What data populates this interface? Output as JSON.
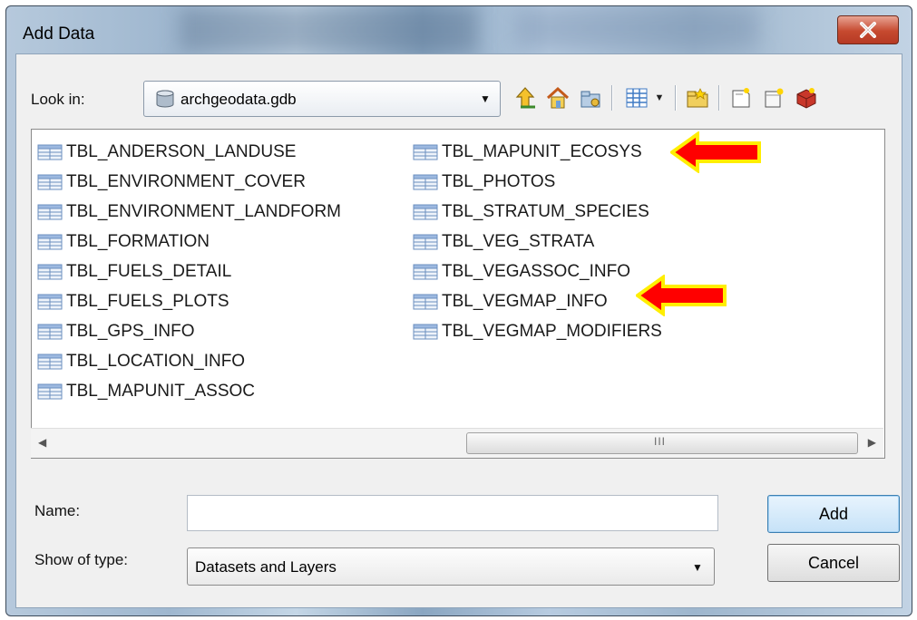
{
  "window": {
    "title": "Add Data"
  },
  "look_in": {
    "label": "Look in:",
    "value": "archgeodata.gdb"
  },
  "toolbar": {
    "icons": [
      "up-one-level-icon",
      "home-icon",
      "connect-folder-icon",
      "view-list-icon",
      "new-folder-icon",
      "new-file-icon",
      "new-shapefile-icon",
      "toolbox-icon"
    ]
  },
  "files": {
    "column1": [
      "TBL_ANDERSON_LANDUSE",
      "TBL_ENVIRONMENT_COVER",
      "TBL_ENVIRONMENT_LANDFORM",
      "TBL_FORMATION",
      "TBL_FUELS_DETAIL",
      "TBL_FUELS_PLOTS",
      "TBL_GPS_INFO",
      "TBL_LOCATION_INFO",
      "TBL_MAPUNIT_ASSOC"
    ],
    "column2": [
      "TBL_MAPUNIT_ECOSYS",
      "TBL_PHOTOS",
      "TBL_STRATUM_SPECIES",
      "TBL_VEG_STRATA",
      "TBL_VEGASSOC_INFO",
      "TBL_VEGMAP_INFO",
      "TBL_VEGMAP_MODIFIERS"
    ],
    "highlighted": [
      "TBL_MAPUNIT_ECOSYS",
      "TBL_VEGMAP_INFO"
    ]
  },
  "scrollbar": {
    "grip": "III"
  },
  "name_field": {
    "label": "Name:",
    "value": ""
  },
  "type_field": {
    "label": "Show of type:",
    "value": "Datasets and Layers"
  },
  "buttons": {
    "add": "Add",
    "cancel": "Cancel"
  },
  "colors": {
    "arrow_fill": "#ff0000",
    "arrow_outline": "#ffee00"
  }
}
